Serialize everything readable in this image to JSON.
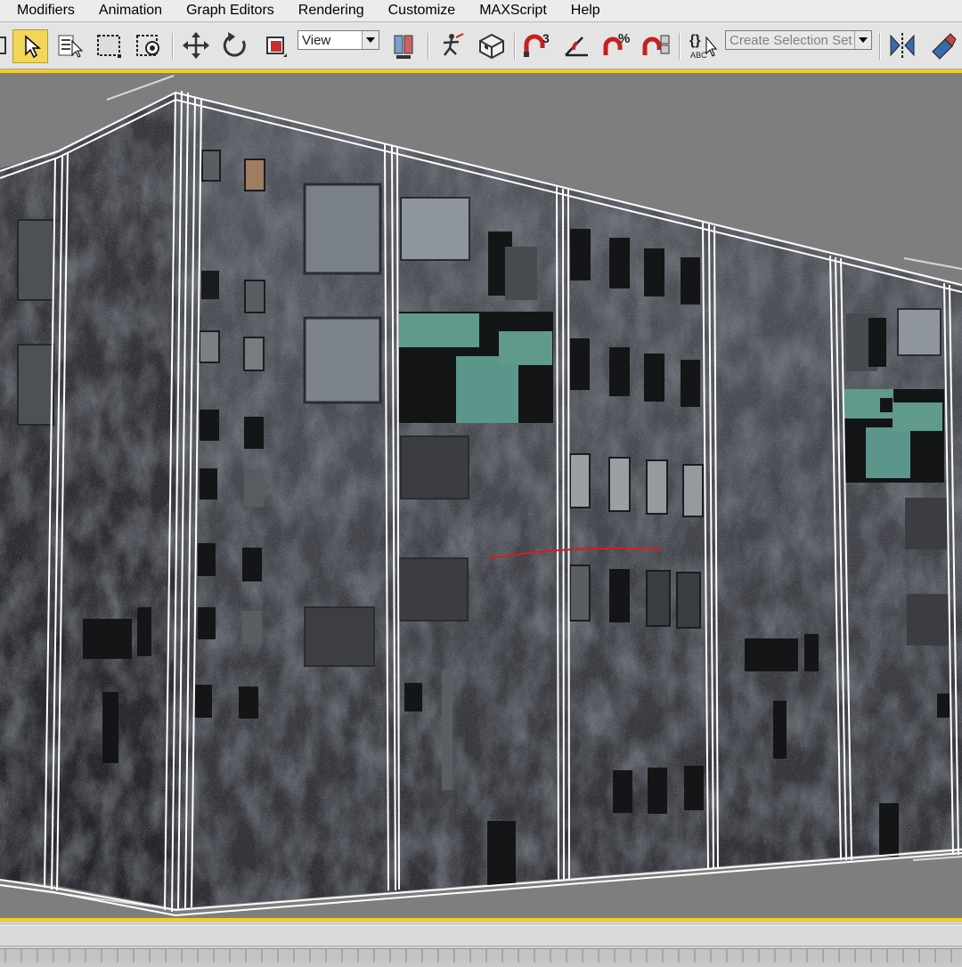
{
  "menubar": {
    "items": [
      "Modifiers",
      "Animation",
      "Graph Editors",
      "Rendering",
      "Customize",
      "MAXScript",
      "Help"
    ]
  },
  "toolbar": {
    "reference_coord": "View",
    "selection_set_placeholder": "Create Selection Set",
    "snap_count_label": "3",
    "percent_label": "%",
    "edit_named_label": "ABC",
    "active_tool": "select-object",
    "accent": "#f3d55a"
  },
  "viewport": {
    "background": "#7e7e7e",
    "active_border": "#f2cc2e",
    "wire_color": "#ffffff",
    "gizmo_color": "#d02020",
    "texture_colors": {
      "wall_dark": "#3a3b40",
      "wall_mid": "#55575d",
      "teal_glass": "#5f9a8c"
    }
  },
  "icons": [
    "select-icon",
    "select-by-name-icon",
    "rect-region-icon",
    "window-crossing-icon",
    "move-icon",
    "rotate-icon",
    "scale-icon",
    "pivot-icon",
    "manipulate-icon",
    "keyboard-shortcut-icon",
    "snap-icon",
    "angle-snap-icon",
    "percent-snap-icon",
    "spinner-snap-icon",
    "edit-named-sets-icon",
    "mirror-icon",
    "align-icon"
  ]
}
